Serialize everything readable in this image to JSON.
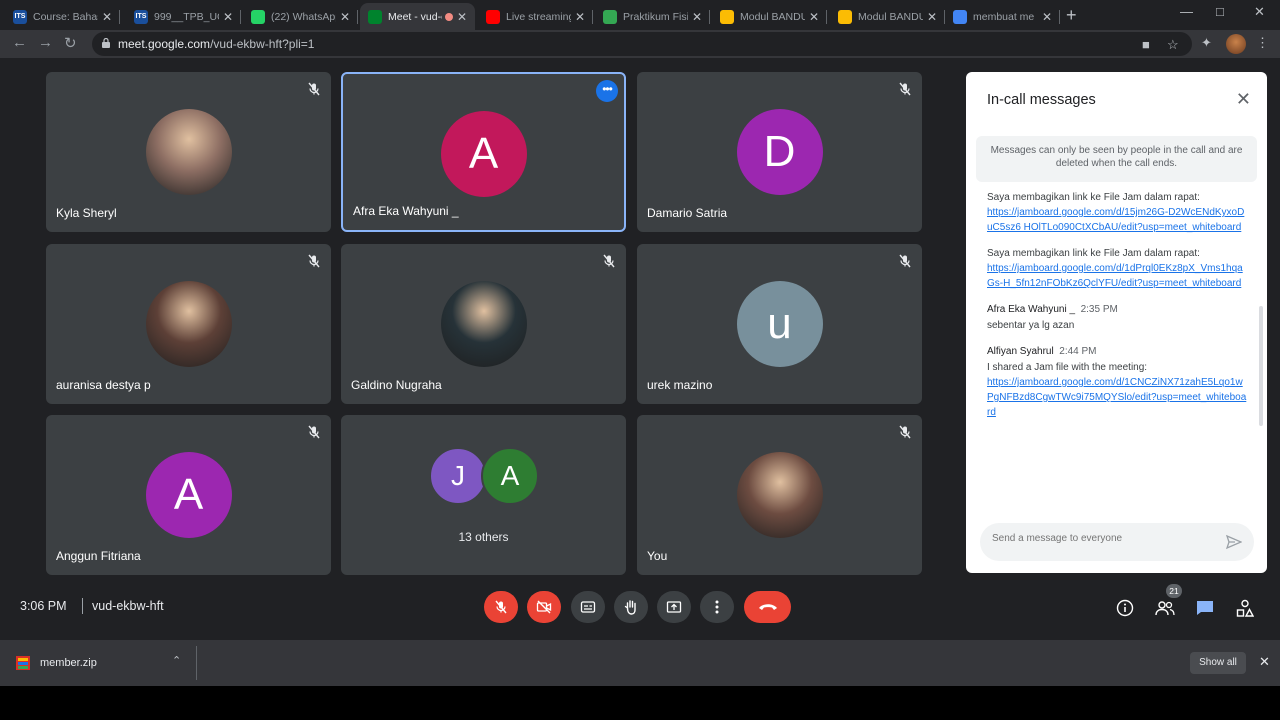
{
  "browser": {
    "tabs": [
      {
        "title": "Course: Bahasa",
        "favicon": "its-icon",
        "favicon_text": "ITS",
        "color": "#1a4f9c"
      },
      {
        "title": "999__TPB_UG",
        "favicon": "its-icon",
        "favicon_text": "ITS",
        "color": "#1a4f9c"
      },
      {
        "title": "(22) WhatsApp",
        "favicon": "whatsapp-icon",
        "favicon_text": "",
        "color": "#25d366"
      },
      {
        "title": "Meet - vud-ekbw-hft",
        "favicon": "meet-icon",
        "favicon_text": "",
        "color": "#00832d",
        "active": true,
        "recording": true
      },
      {
        "title": "Live streaming",
        "favicon": "youtube-icon",
        "favicon_text": "",
        "color": "#ff0000"
      },
      {
        "title": "Praktikum Fisika",
        "favicon": "leaf-icon",
        "favicon_text": "",
        "color": "#34a853"
      },
      {
        "title": "Modul BANDUL",
        "favicon": "drive-icon",
        "favicon_text": "",
        "color": "#fbbc04"
      },
      {
        "title": "Modul BANDUL",
        "favicon": "drive-icon",
        "favicon_text": "",
        "color": "#fbbc04"
      },
      {
        "title": "membuat me",
        "favicon": "google-icon",
        "favicon_text": "",
        "color": "#4285f4"
      }
    ],
    "url_host": "meet.google.com",
    "url_path": "/vud-ekbw-hft?pli=1"
  },
  "participants": [
    {
      "name": "Kyla Sheryl",
      "initial": "",
      "color": "#8d6e63",
      "photo": true,
      "muted": true
    },
    {
      "name": "Afra Eka Wahyuni _",
      "initial": "A",
      "color": "#c2185b",
      "photo": false,
      "muted": false,
      "speaking": true
    },
    {
      "name": "Damario Satria",
      "initial": "D",
      "color": "#9c27b0",
      "photo": false,
      "muted": true
    },
    {
      "name": "auranisa destya p",
      "initial": "",
      "color": "#5d4037",
      "photo": true,
      "muted": true
    },
    {
      "name": "Galdino Nugraha",
      "initial": "",
      "color": "#263238",
      "photo": true,
      "muted": true
    },
    {
      "name": "urek mazino",
      "initial": "u",
      "color": "#78909c",
      "photo": false,
      "muted": true
    },
    {
      "name": "Anggun Fitriana",
      "initial": "A",
      "color": "#9c27b0",
      "photo": false,
      "muted": true
    },
    {
      "name": "You",
      "initial": "",
      "color": "#6d4c41",
      "photo": true,
      "muted": true
    }
  ],
  "others_tile": {
    "label": "13 others",
    "avatars": [
      {
        "initial": "J",
        "color": "#7e57c2"
      },
      {
        "initial": "A",
        "color": "#2e7d32"
      }
    ]
  },
  "chat": {
    "title": "In-call messages",
    "notice": "Messages can only be seen by people in the call and are deleted when the call ends.",
    "messages": [
      {
        "sender": "",
        "time": "",
        "text": "Saya membagikan link ke File Jam dalam rapat:",
        "link": "https://jamboard.google.com/d/15jm26G-D2WcENdKyxoDuC5sz6 HOlTLo090CtXCbAU/edit?usp=meet_whiteboard"
      },
      {
        "sender": "",
        "time": "",
        "text": "Saya membagikan link ke File Jam dalam rapat:",
        "link": "https://jamboard.google.com/d/1dPrql0EKz8pX_Vms1hqaGs-H_5fn12nFObKz6QclYFU/edit?usp=meet_whiteboard"
      },
      {
        "sender": "Afra Eka Wahyuni _",
        "time": "2:35 PM",
        "text": "sebentar ya lg azan",
        "link": ""
      },
      {
        "sender": "Alfiyan Syahrul",
        "time": "2:44 PM",
        "text": "I shared a Jam file with the meeting:",
        "link": "https://jamboard.google.com/d/1CNCZiNX71zahE5Lqo1wPgNFBzd8CgwTWc9i75MQYSlo/edit?usp=meet_whiteboard"
      }
    ],
    "input_placeholder": "Send a message to everyone"
  },
  "bottom_bar": {
    "time": "3:06 PM",
    "meeting_code": "vud-ekbw-hft",
    "participant_count": "21"
  },
  "downloads": {
    "file": "member.zip",
    "show_all": "Show all"
  }
}
